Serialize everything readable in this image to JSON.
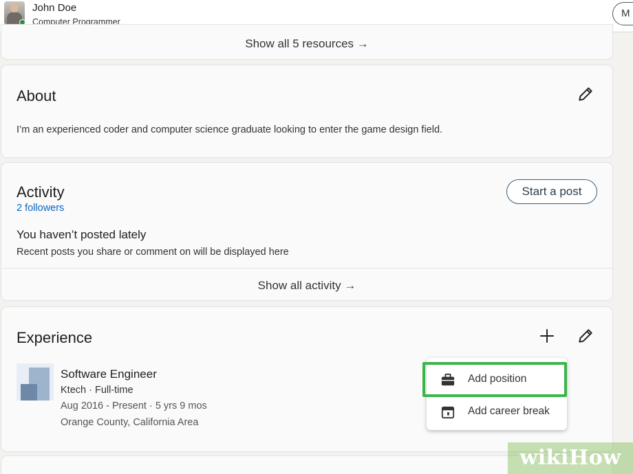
{
  "header": {
    "name": "John Doe",
    "subtitle": "Computer Programmer",
    "more_button_label": "M"
  },
  "resources": {
    "show_all_label": "Show all 5 resources →"
  },
  "about": {
    "title": "About",
    "text": "I’m an experienced coder and computer science graduate looking to enter the game design field."
  },
  "activity": {
    "title": "Activity",
    "followers": "2 followers",
    "start_post_label": "Start a post",
    "empty_title": "You haven’t posted lately",
    "empty_text": "Recent posts you share or comment on will be displayed here",
    "show_all_label": "Show all activity →"
  },
  "experience": {
    "title": "Experience",
    "job": {
      "title": "Software Engineer",
      "company_line": "Ktech · Full-time",
      "dates": "Aug 2016 - Present · 5 yrs 9 mos",
      "location": "Orange County, California Area"
    },
    "add_menu": [
      {
        "label": "Add position",
        "icon": "briefcase-icon"
      },
      {
        "label": "Add career break",
        "icon": "calendar-icon"
      }
    ]
  },
  "watermark": "wikiHow",
  "colors": {
    "highlight": "#3bb54a",
    "link": "#0a66c2",
    "presence": "#2e8b3b"
  }
}
